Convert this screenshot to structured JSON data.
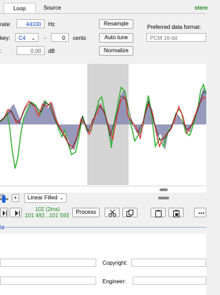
{
  "tabs": [
    {
      "label": "Loop"
    },
    {
      "label": "Source"
    }
  ],
  "top_right_label": "stere",
  "settings": {
    "sample_rate_label": "rate:",
    "sample_rate_value": "44100",
    "sample_rate_unit": "Hz",
    "key_label": "key:",
    "key_value": "C4",
    "dash": "-",
    "cents_value": "0",
    "cents_unit": "cents",
    "gain_label": ":",
    "gain_value": "0.00",
    "gain_unit": "dB"
  },
  "buttons": {
    "resample": "Resample",
    "auto_tune": "Auto tune",
    "normalize": "Normalize",
    "process": "Process"
  },
  "format": {
    "label": "Preferred data format:",
    "value": "PCM 16-bit"
  },
  "toolbar": {
    "zoom_label": "m",
    "plus": "+",
    "display_mode": "Linear Filled",
    "selection_length": "102 (2ms)",
    "selection_range": "101 492...101 593"
  },
  "meta_label": "ta",
  "info_fields": {
    "copyright_label": "Copyright:",
    "engineer_label": "Engineer:"
  },
  "colors": {
    "accent_blue": "#0a3ec2",
    "green_text": "#1f8a1f",
    "wave_fill": "#8c8fb2",
    "wave_green": "#3cb43c",
    "wave_red": "#e8383c",
    "selection": "#d4d4d4"
  }
}
